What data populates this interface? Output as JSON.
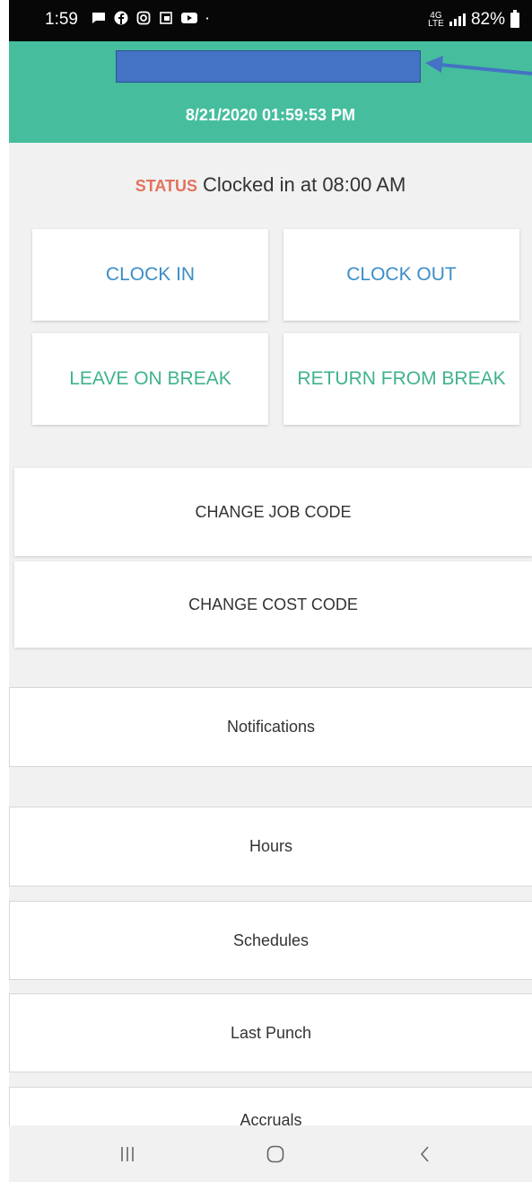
{
  "status_bar": {
    "time": "1:59",
    "notification_icons": [
      "message-icon",
      "facebook-icon",
      "instagram-icon",
      "cast-icon",
      "youtube-icon",
      "dot-icon"
    ],
    "network": "4G LTE",
    "battery": "82%"
  },
  "header": {
    "datetime": "8/21/2020 01:59:53 PM",
    "bg_color": "#46be9d",
    "redaction_color": "#4472c4"
  },
  "status": {
    "label": "STATUS",
    "text": "Clocked in at 08:00 AM"
  },
  "punch_buttons": {
    "clock_in": "CLOCK IN",
    "clock_out": "CLOCK OUT",
    "leave_break": "LEAVE ON BREAK",
    "return_break": "RETURN FROM BREAK"
  },
  "change_buttons": {
    "job_code": "CHANGE JOB CODE",
    "cost_code": "CHANGE COST CODE"
  },
  "menu": {
    "notifications": "Notifications",
    "hours": "Hours",
    "schedules": "Schedules",
    "last_punch": "Last Punch",
    "accruals": "Accruals"
  },
  "nav_bar": [
    "recent-apps-icon",
    "home-icon",
    "back-icon"
  ]
}
